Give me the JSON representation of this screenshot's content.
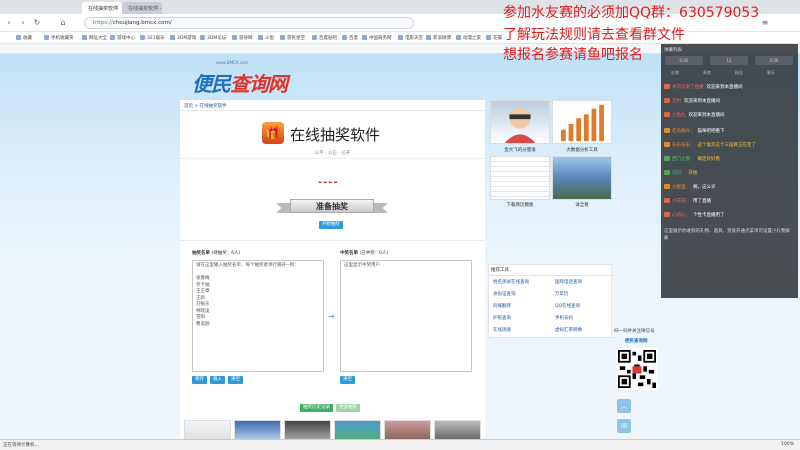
{
  "browser": {
    "tabs": [
      {
        "label": "在线抽奖软件",
        "active": true
      },
      {
        "label": "在线抽奖软件 -",
        "active": false
      }
    ],
    "url_scheme": "https://",
    "url_rest": "choujiang.bmcx.com/",
    "bookmarks": [
      "收藏",
      "手机收藏夹",
      "网址大全",
      "游戏中心",
      "321娱乐",
      "3DM游戏",
      "3DM论坛",
      "游侠网",
      "斗鱼",
      "游民星空",
      "百度贴吧",
      "百度",
      "中国商务网",
      "电影天堂",
      "新浪微博",
      "动漫之家",
      "花瓣"
    ],
    "status_text": "正在等待计算机...",
    "zoom": "100%"
  },
  "overlay": {
    "line1": "参加水友赛的必须加QQ群：630579053",
    "line2": "了解玩法规则请去查看群文件",
    "line3": "想报名参赛请鱼吧报名"
  },
  "site": {
    "logo_site": "www.BMCX.com",
    "logo_name_a": "便民",
    "logo_name_b": "查询网",
    "breadcrumb": "首页 > 在线抽奖软件",
    "app_title": "在线抽奖软件",
    "tags": "公平 · 公正 · 公开",
    "draw_dashes": "----",
    "ribbon_label": "准备抽奖",
    "start_button": "开始抽奖",
    "list_label": "抽奖名单",
    "list_count": "(待抽奖：6人)",
    "winner_label": "中奖名单",
    "winner_count": "(已中奖：0人)",
    "list_placeholder": "请在这里输入抽奖名单，每个抽奖者单行隔开~例：\n\n张春梅\n罗卡福\n王正章\n王新\n刘振东\n林晓凌\n雪阳\n曹美鸥",
    "winner_placeholder": "这里显示中奖用户",
    "btn_save": "保存",
    "btn_import": "载入",
    "btn_clear": "清空",
    "btn_clear2": "清空",
    "btn_record": "抽奖历史记录",
    "btn_other": "更多抽奖",
    "right_captions": [
      "变大飞的分量值",
      "大数据分析工具",
      "下载简历模板",
      "详全看"
    ],
    "tools_title": "推荐工具",
    "tools": [
      "姓名测试在线查询",
      "国际电话查询",
      "身份证查询",
      "万年历",
      "同城翻译",
      "QQ在线查询",
      "护照查询",
      "手机号码",
      "在线测速",
      "虚拟汇率转换"
    ],
    "qr_title": "扫一扫并关注微信号",
    "qr_brand": "便民查询网"
  },
  "chat": {
    "title": "弹幕列表",
    "pills": [
      "0.00",
      "11",
      "0.00"
    ],
    "subtabs": [
      "礼物",
      "贵宾",
      "粉丝",
      "聊天"
    ],
    "messages": [
      {
        "name": "水司马进了直播",
        "text": "欢迎来到本直播间",
        "color": "#f06a6a"
      },
      {
        "name": "吉利",
        "text": "欢迎来到本直播间",
        "color": "#f06a6a"
      },
      {
        "name": "小鱼丸",
        "text": "欢迎来到本直播间",
        "color": "#f06a6a"
      },
      {
        "name": "吃瓜群众：",
        "text": "猫咪吧吧看下",
        "color": "#f08a3a"
      },
      {
        "name": "乐乐乐乐：",
        "text": "这个喜欢这个三国真正在定了",
        "color": "#f08a3a"
      },
      {
        "name": "西门之春：",
        "text": "确定好好看",
        "color": "#4fc06a"
      },
      {
        "name": "闪闪：",
        "text": "开始",
        "color": "#4fc06a"
      },
      {
        "name": "小屋里：",
        "text": "啊，这么许",
        "color": "#f08a3a"
      },
      {
        "name": "小花花：",
        "text": "用了直播",
        "color": "#f06a6a"
      },
      {
        "name": "心语心：",
        "text": "个性卡直播用了",
        "color": "#f06a6a"
      }
    ],
    "notice": "这里展示你收到的礼物、道具、贵族开通点菜单可设置小礼物屏蔽"
  }
}
